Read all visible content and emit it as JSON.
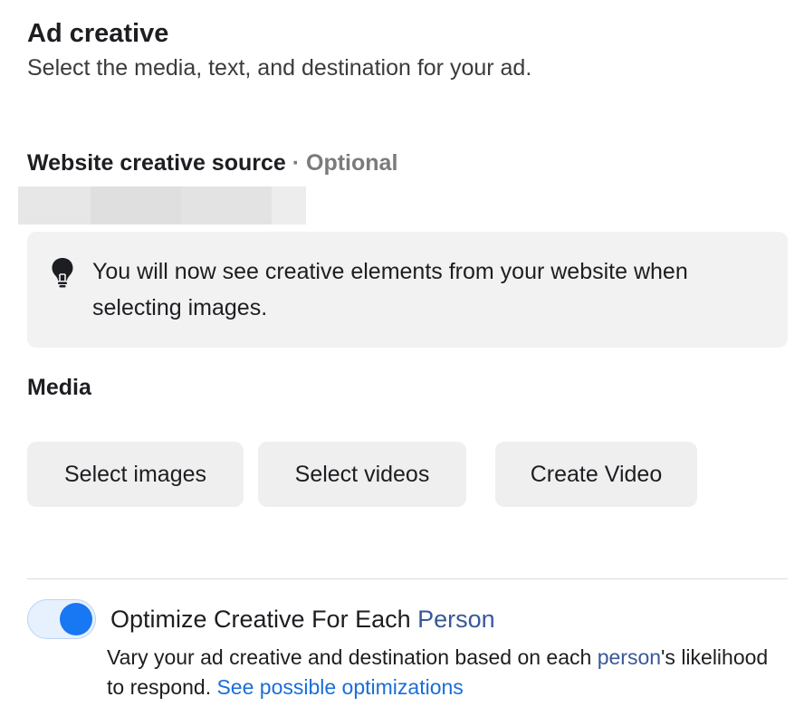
{
  "header": {
    "title": "Ad creative",
    "subtitle": "Select the media, text, and destination for your ad."
  },
  "website_source": {
    "label": "Website creative source",
    "separator": " · ",
    "optional": "Optional"
  },
  "notice": {
    "icon": "lightbulb-icon",
    "text": "You will now see creative elements from your website when selecting images."
  },
  "media": {
    "label": "Media",
    "buttons": {
      "select_images": "Select images",
      "select_videos": "Select videos",
      "create_video": "Create Video"
    }
  },
  "optimize": {
    "enabled": true,
    "label_prefix": "Optimize Creative For Each ",
    "label_link": "Person",
    "desc_part1": "Vary your ad creative and destination based on each ",
    "desc_link_person": "person",
    "desc_part2": "'s likelihood to respond. ",
    "desc_link_see": "See possible optimizations"
  },
  "colors": {
    "accent": "#1877f2",
    "link": "#385898",
    "link_bright": "#1a6ed8",
    "notice_bg": "#f2f2f2",
    "button_bg": "#efefef"
  }
}
